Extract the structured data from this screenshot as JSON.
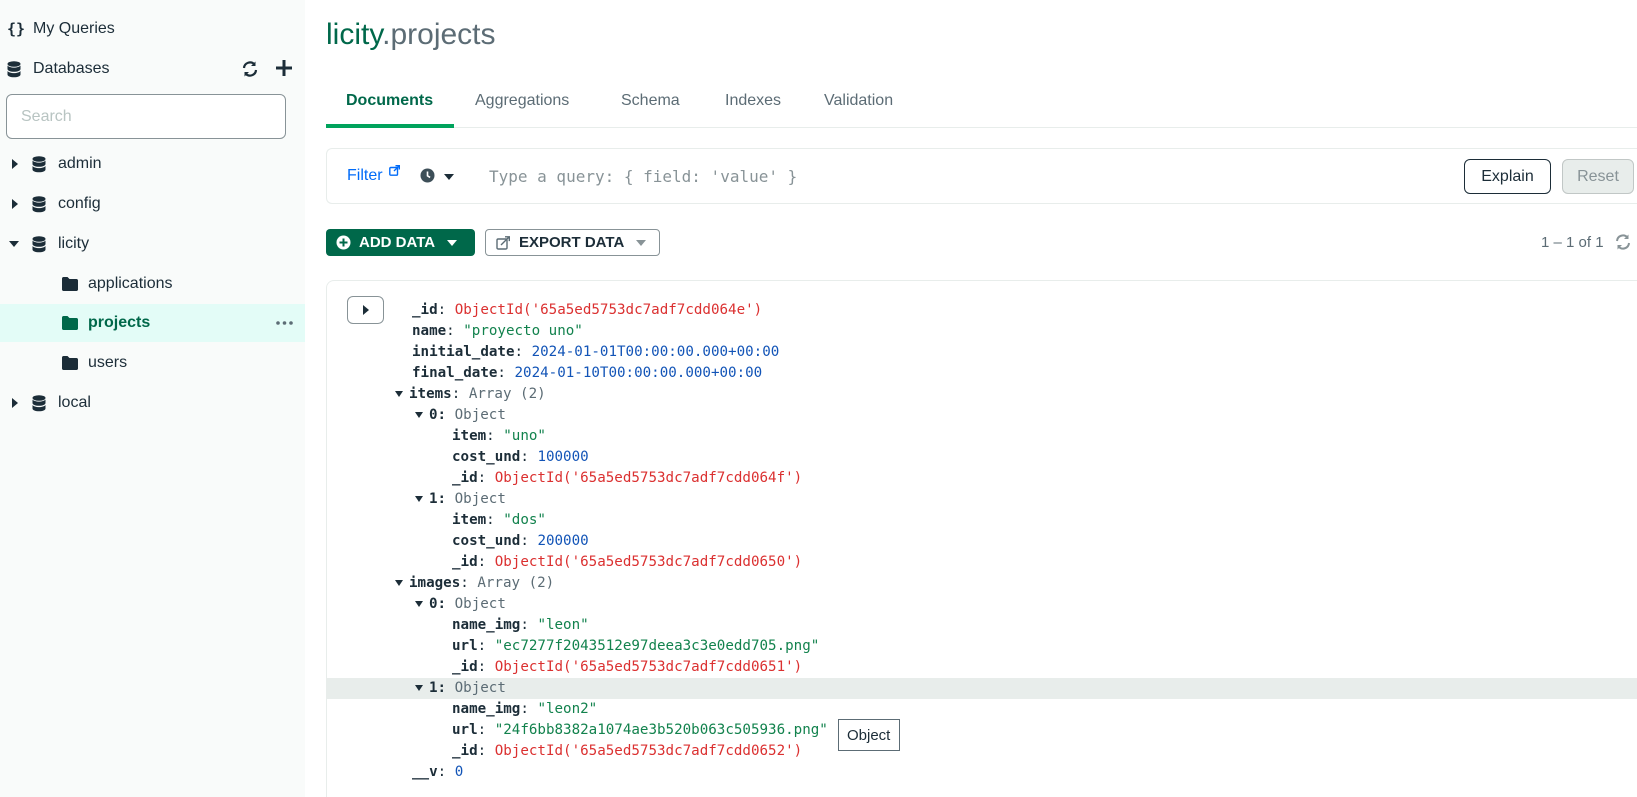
{
  "sidebar": {
    "my_queries": "My Queries",
    "databases": "Databases",
    "search_placeholder": "Search",
    "tree": [
      {
        "label": "admin"
      },
      {
        "label": "config"
      },
      {
        "label": "licity"
      },
      {
        "label": "applications"
      },
      {
        "label": "projects"
      },
      {
        "label": "users"
      },
      {
        "label": "local"
      }
    ]
  },
  "header": {
    "db": "licity",
    "dot": ".",
    "collection": "projects"
  },
  "tabs": [
    "Documents",
    "Aggregations",
    "Schema",
    "Indexes",
    "Validation"
  ],
  "filter": {
    "label": "Filter",
    "placeholder": "Type a query: { field: 'value' }",
    "explain": "Explain",
    "reset": "Reset"
  },
  "toolbar": {
    "add_data": "ADD DATA",
    "export_data": "EXPORT DATA",
    "pagination": "1 – 1 of 1"
  },
  "document": {
    "id_key": "_id",
    "id_val": "ObjectId('65a5ed5753dc7adf7cdd064e')",
    "name_key": "name",
    "name_val": "\"proyecto uno\"",
    "initial_key": "initial_date",
    "initial_val": "2024-01-01T00:00:00.000+00:00",
    "final_key": "final_date",
    "final_val": "2024-01-10T00:00:00.000+00:00",
    "items_key": "items",
    "items_type": "Array (2)",
    "items": [
      {
        "idx": "0",
        "type": "Object",
        "item_key": "item",
        "item_val": "\"uno\"",
        "cost_key": "cost_und",
        "cost_val": "100000",
        "id_key": "_id",
        "id_val": "ObjectId('65a5ed5753dc7adf7cdd064f')"
      },
      {
        "idx": "1",
        "type": "Object",
        "item_key": "item",
        "item_val": "\"dos\"",
        "cost_key": "cost_und",
        "cost_val": "200000",
        "id_key": "_id",
        "id_val": "ObjectId('65a5ed5753dc7adf7cdd0650')"
      }
    ],
    "images_key": "images",
    "images_type": "Array (2)",
    "images": [
      {
        "idx": "0",
        "type": "Object",
        "name_key": "name_img",
        "name_val": "\"leon\"",
        "url_key": "url",
        "url_val": "\"ec7277f2043512e97deea3c3e0edd705.png\"",
        "id_key": "_id",
        "id_val": "ObjectId('65a5ed5753dc7adf7cdd0651')"
      },
      {
        "idx": "1",
        "type": "Object",
        "name_key": "name_img",
        "name_val": "\"leon2\"",
        "url_key": "url",
        "url_val": "\"24f6bb8382a1074ae3b520b063c505936.png\"",
        "id_key": "_id",
        "id_val": "ObjectId('65a5ed5753dc7adf7cdd0652')"
      }
    ],
    "v_key": "__v",
    "v_val": "0"
  },
  "tooltip": "Object"
}
